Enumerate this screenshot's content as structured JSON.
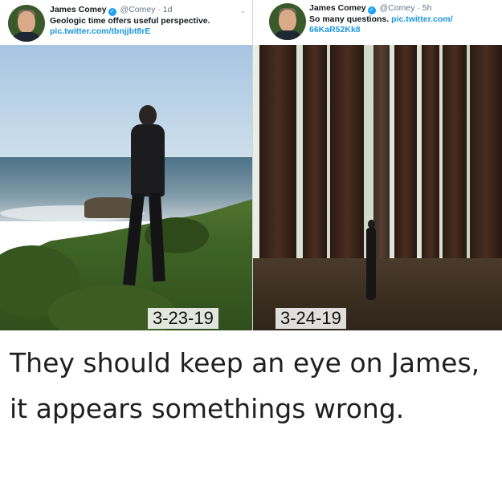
{
  "tweets": [
    {
      "name": "James Comey",
      "handle": "@Comey · 1d",
      "text": "Geologic time offers useful perspective.",
      "link": "pic.twitter.com/tbnjjbt8rE",
      "date_caption": "3-23-19"
    },
    {
      "name": "James Comey",
      "handle": "@Comey · 5h",
      "text": "So many questions.",
      "link": "pic.twitter.com/ 66KaR52Kk8",
      "date_caption": "3-24-19"
    }
  ],
  "icons": {
    "verified": "verified-badge-icon",
    "caret": "chevron-down-icon"
  },
  "colors": {
    "link": "#1b95e0",
    "verified": "#1da1f2",
    "caption_text": "#1f1f1f"
  },
  "caption": "They should keep an eye on James, it appears somethings wrong."
}
